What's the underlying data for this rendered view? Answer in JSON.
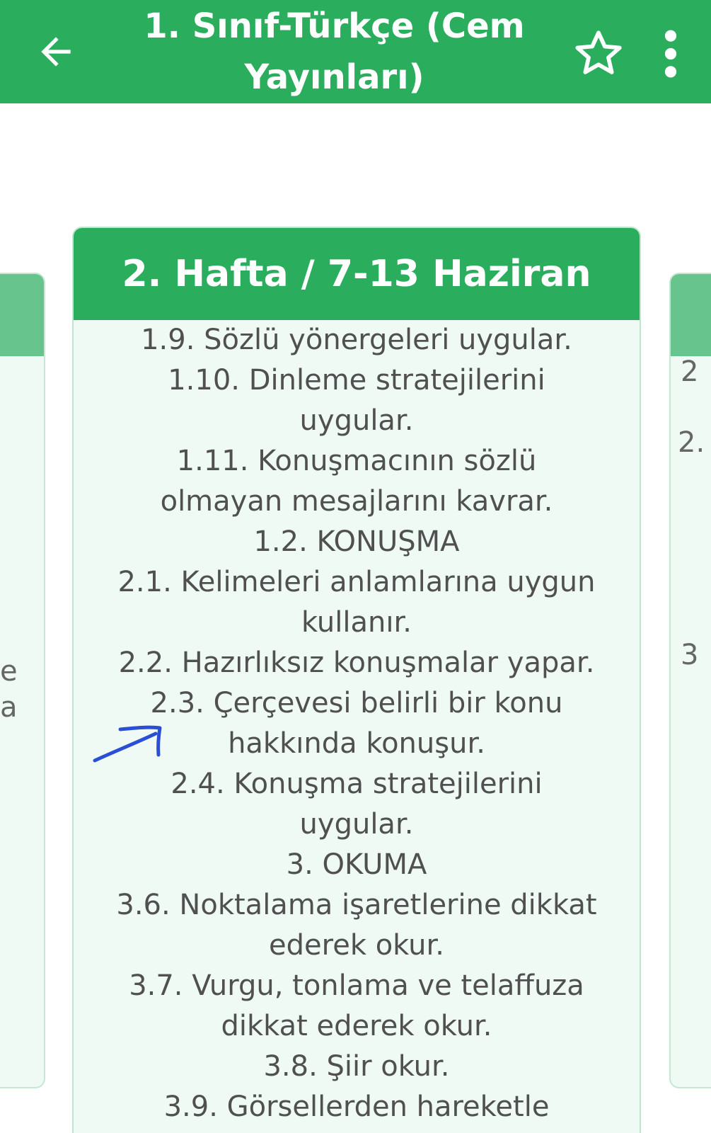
{
  "appbar": {
    "title": "1. Sınıf-Türkçe (Cem Yayınları)",
    "back_icon": "arrow-left-icon",
    "favorite_icon": "star-outline-icon",
    "menu_icon": "more-vert-icon",
    "bar_color": "#2aae5e"
  },
  "card": {
    "header": "2. Hafta / 7-13 Haziran",
    "items": [
      "1.9. Sözlü yönergeleri uygular.",
      "1.10. Dinleme stratejilerini uygular.",
      "1.11. Konuşmacının sözlü olmayan mesajlarını kavrar.",
      "1.2. KONUŞMA",
      "2.1. Kelimeleri anlamlarına uygun kullanır.",
      "2.2. Hazırlıksız konuşmalar yapar.",
      "2.3. Çerçevesi belirli bir konu hakkında konuşur.",
      "2.4. Konuşma stratejilerini uygular.",
      "3. OKUMA",
      "3.6. Noktalama işaretlerine dikkat ederek okur.",
      "3.7. Vurgu, tonlama ve telaffuza dikkat ederek okur.",
      "3.8. Şiir okur.",
      "3.9. Görsellerden hareketle"
    ]
  },
  "left_card": {
    "fragments": [
      "e",
      "a"
    ]
  },
  "right_card": {
    "fragments": [
      "2",
      "2.",
      "3"
    ]
  },
  "annotation": {
    "icon": "hand-drawn-arrow-icon",
    "color": "#2a4fd6"
  }
}
